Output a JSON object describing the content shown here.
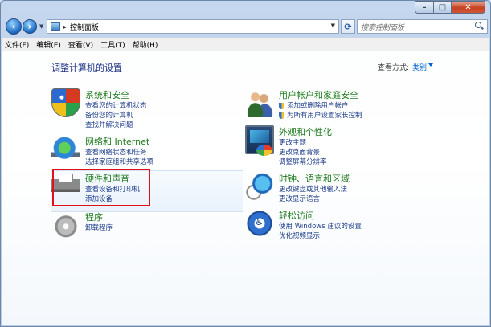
{
  "address": {
    "path": "控制面板"
  },
  "search": {
    "placeholder": "搜索控制面板"
  },
  "menu": [
    "文件(F)",
    "编辑(E)",
    "查看(V)",
    "工具(T)",
    "帮助(H)"
  ],
  "page": {
    "title": "调整计算机的设置",
    "view_by_label": "查看方式:",
    "view_by_value": "类别"
  },
  "categories": {
    "system": {
      "title": "系统和安全",
      "links": [
        "查看您的计算机状态",
        "备份您的计算机",
        "查找并解决问题"
      ],
      "icon": "shield-icon"
    },
    "network": {
      "title": "网络和 Internet",
      "links": [
        "查看网络状态和任务",
        "选择家庭组和共享选项"
      ],
      "icon": "network-icon"
    },
    "hardware": {
      "title": "硬件和声音",
      "links": [
        "查看设备和打印机",
        "添加设备"
      ],
      "icon": "printer-icon"
    },
    "programs": {
      "title": "程序",
      "links": [
        "卸载程序"
      ],
      "icon": "programs-icon"
    },
    "users": {
      "title": "用户帐户和家庭安全",
      "links": [
        "添加或删除用户帐户",
        "为所有用户设置家长控制"
      ],
      "icon": "users-icon"
    },
    "appearance": {
      "title": "外观和个性化",
      "links": [
        "更改主题",
        "更改桌面背景",
        "调整屏幕分辨率"
      ],
      "icon": "appearance-icon"
    },
    "clock": {
      "title": "时钟、语言和区域",
      "links": [
        "更改键盘或其他输入法",
        "更改显示语言"
      ],
      "icon": "clock-icon"
    },
    "access": {
      "title": "轻松访问",
      "links": [
        "使用 Windows 建议的设置",
        "优化视频显示"
      ],
      "icon": "accessibility-icon"
    }
  },
  "colors": {
    "category_title": "#1e7a1e",
    "link": "#1e3d8a",
    "highlight": "#e0101d"
  }
}
